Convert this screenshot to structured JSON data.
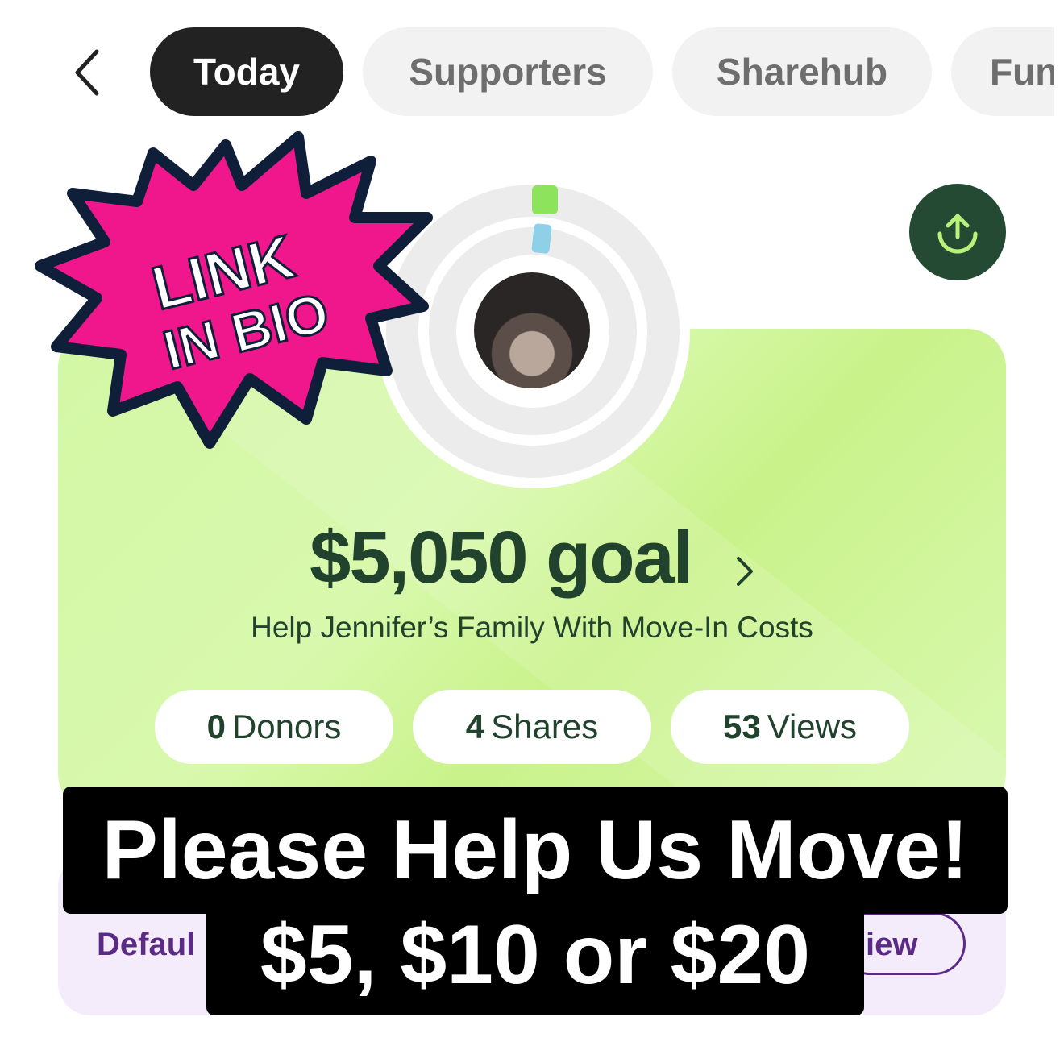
{
  "tabs": [
    {
      "label": "Today",
      "active": true
    },
    {
      "label": "Supporters",
      "active": false
    },
    {
      "label": "Sharehub",
      "active": false
    },
    {
      "label": "Fun",
      "active": false
    }
  ],
  "sticker": {
    "line1": "LINK",
    "line2": "IN BIO"
  },
  "progress": {
    "fraction": 0.0
  },
  "goal": {
    "text": "$5,050 goal"
  },
  "campaign_title": "Help Jennifer’s Family With Move-In Costs",
  "stats": [
    {
      "count": "0",
      "label": "Donors"
    },
    {
      "count": "4",
      "label": "Shares"
    },
    {
      "count": "53",
      "label": "Views"
    }
  ],
  "lower": {
    "left_text": "Defaul",
    "right_text": "iew"
  },
  "overlay": {
    "line1": "Please Help Us Move!",
    "line2": "$5, $10 or $20"
  },
  "colors": {
    "accent_dark": "#244a33",
    "card_green": "#d2f7a4",
    "tab_active": "#222222",
    "sticker_pink": "#f0168c",
    "purple": "#5b2a86"
  }
}
